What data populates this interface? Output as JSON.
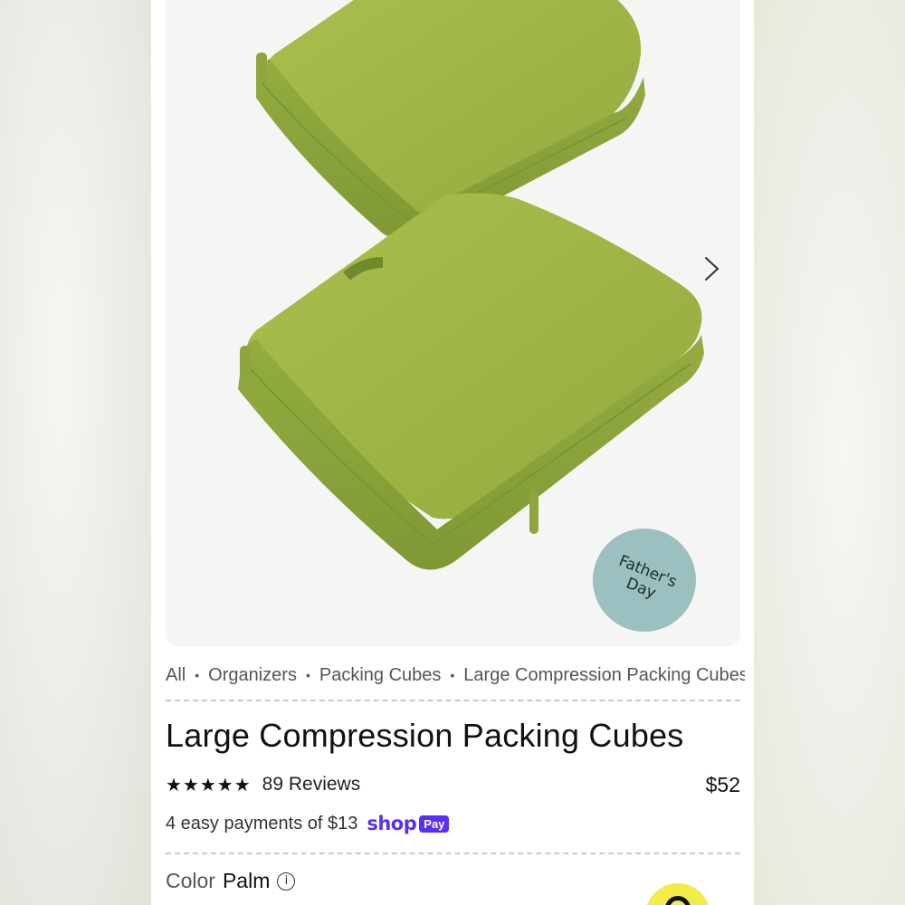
{
  "badge": {
    "text": "Father's\nDay"
  },
  "breadcrumb": {
    "items": [
      "All",
      "Organizers",
      "Packing Cubes",
      "Large Compression Packing Cubes"
    ],
    "separator": "•"
  },
  "product": {
    "title": "Large Compression Packing Cubes",
    "stars": "★★★★★",
    "reviews": "89 Reviews",
    "price": "$52",
    "installments": "4 easy payments of $13",
    "shop_logo_shop": "shop",
    "shop_logo_pay": "Pay",
    "color_label": "Color",
    "color_value": "Palm",
    "info_icon": "i"
  },
  "colors": {
    "product_green": "#9db64a",
    "badge_teal": "#9cbfc0",
    "shop_purple": "#5a31f4",
    "chat_yellow": "#f2ec48"
  },
  "icons": {
    "next": "chevron-right-icon",
    "info": "info-icon",
    "chat": "chat-icon"
  }
}
